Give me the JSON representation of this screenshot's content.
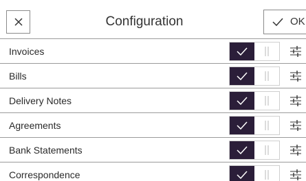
{
  "header": {
    "title": "Configuration",
    "ok_label": "OK"
  },
  "items": [
    {
      "label": "Invoices",
      "enabled": true
    },
    {
      "label": "Bills",
      "enabled": true
    },
    {
      "label": "Delivery Notes",
      "enabled": true
    },
    {
      "label": "Agreements",
      "enabled": true
    },
    {
      "label": "Bank Statements",
      "enabled": true
    },
    {
      "label": "Correspondence",
      "enabled": true
    }
  ],
  "icons": {
    "close": "close-icon",
    "ok": "check-icon",
    "toggle_on": "check-icon",
    "toggle_off": "pause-icon",
    "row_settings": "sliders-icon"
  },
  "colors": {
    "toggle_on_bg": "#2b1e39",
    "border": "#8a8a8a"
  }
}
